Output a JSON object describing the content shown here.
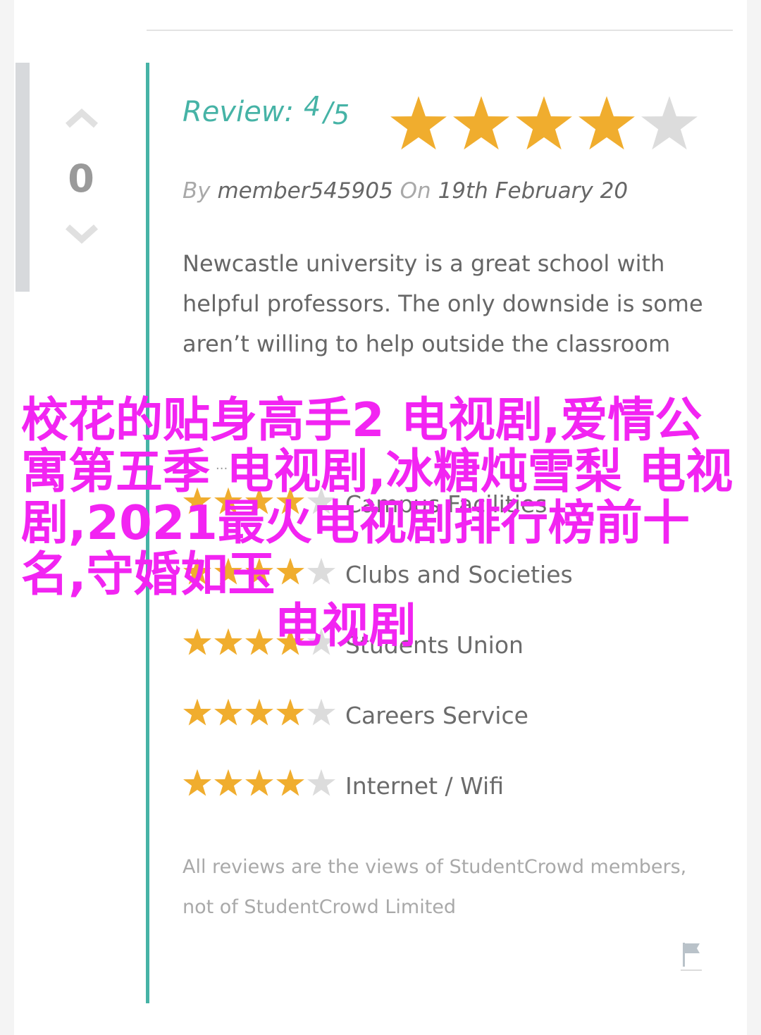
{
  "votes": {
    "count": "0"
  },
  "review": {
    "label": "Review:",
    "score": "4",
    "slash": "/",
    "out_of": "5",
    "rating_value": 4,
    "rating_max": 5,
    "by_label": "By",
    "author": "member545905",
    "on_label": "On",
    "date": "19th February 20",
    "text": "Newcastle university is a great school with helpful professors. The only downside is some aren’t willing to help outside the classroom"
  },
  "more_ellipsis": "...",
  "category_ratings": [
    {
      "label": "Campus Facilities",
      "stars": 4,
      "max": 5
    },
    {
      "label": "Clubs and Societies",
      "stars": 4,
      "max": 5
    },
    {
      "label": "Students Union",
      "stars": 4,
      "max": 5
    },
    {
      "label": "Careers Service",
      "stars": 4,
      "max": 5
    },
    {
      "label": "Internet / Wifi",
      "stars": 4,
      "max": 5
    }
  ],
  "disclaimer": "All reviews are the views of StudentCrowd members, not of StudentCrowd Limited",
  "overlay": {
    "text": "校花的贴身高手2 电视剧,爱情公寓第五季 电视剧,冰糖炖雪梨 电视剧,2021最火电视剧排行榜前十名,守婚如玉",
    "last_line": "电视剧"
  },
  "colors": {
    "accent_teal": "#46b3a6",
    "star_filled": "#f0ad2e",
    "star_empty": "#dcdcdc",
    "overlay_magenta": "#f224f2"
  },
  "icons": {
    "vote_up": "chevron-up-icon",
    "vote_down": "chevron-down-icon",
    "report": "flag-icon"
  }
}
